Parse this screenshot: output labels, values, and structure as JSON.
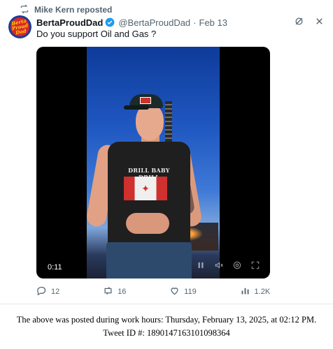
{
  "repost": {
    "text": "Mike Kern reposted",
    "icon": "repost-icon"
  },
  "author": {
    "display_name": "BertaProudDad",
    "handle": "@BertaProudDad",
    "separator": "·",
    "date": "Feb 13",
    "avatar_text": "Berta Proud Dad",
    "verified_color": "#1d9bf0"
  },
  "tweet": {
    "text": "Do you support Oil and Gas ?"
  },
  "video": {
    "elapsed": "0:11",
    "shirt_text": "DRILL BABY DRILL",
    "controls": [
      "pause-icon",
      "volume-icon",
      "settings-icon",
      "fullscreen-icon"
    ]
  },
  "actions": {
    "replies": "12",
    "reposts": "16",
    "likes": "119",
    "views": "1.2K"
  },
  "caption": {
    "line1": "The above was posted during work hours: Thursday, February 13, 2025, at 02:12 PM.",
    "line2": "Tweet ID #: 1890147163101098364"
  }
}
